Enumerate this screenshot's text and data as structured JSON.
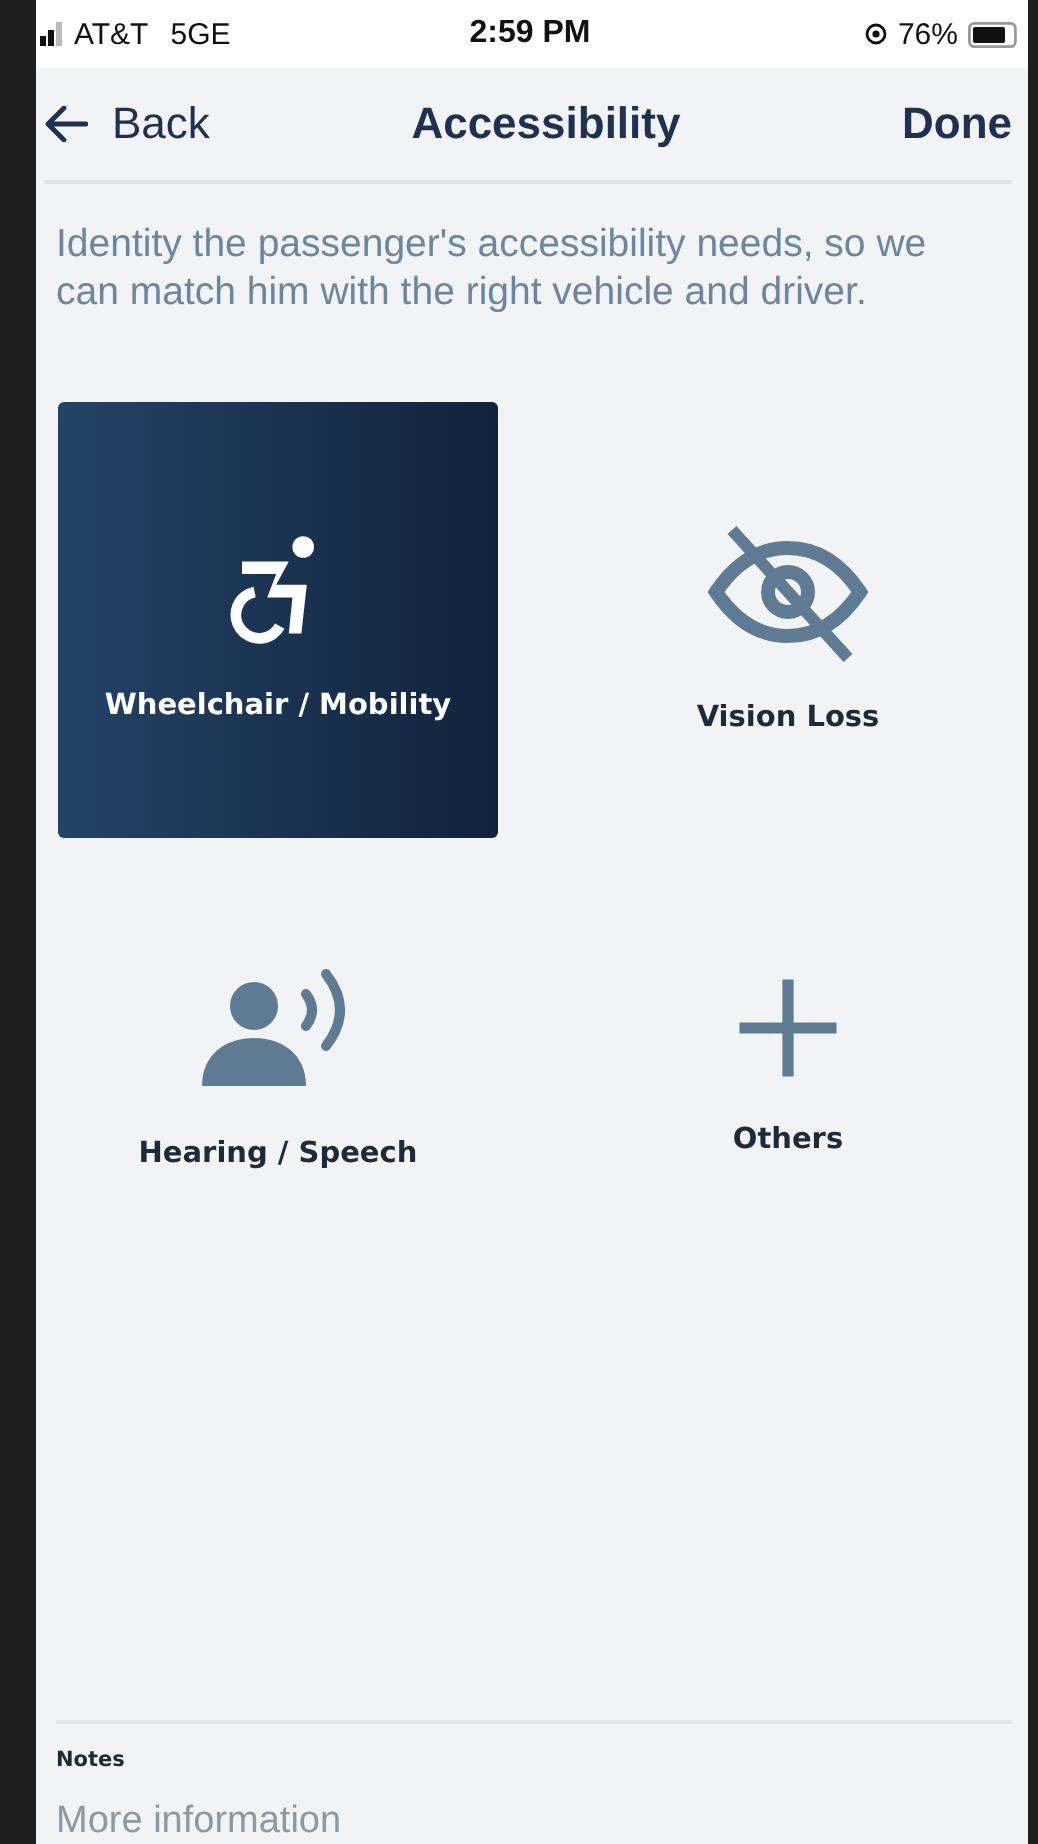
{
  "status_bar": {
    "carrier": "AT&T",
    "network": "5GE",
    "time": "2:59 PM",
    "battery": "76%"
  },
  "nav": {
    "back": "Back",
    "title": "Accessibility",
    "done": "Done"
  },
  "description": "Identity the passenger's accessibility needs, so we can match him with the right vehicle and driver.",
  "options": [
    {
      "kind": "wheelchair",
      "label": "Wheelchair / Mobility",
      "selected": true
    },
    {
      "kind": "vision",
      "label": "Vision Loss",
      "selected": false
    },
    {
      "kind": "hearing",
      "label": "Hearing / Speech",
      "selected": false
    },
    {
      "kind": "other",
      "label": "Others",
      "selected": false
    }
  ],
  "notes": {
    "label": "Notes",
    "placeholder": "More information"
  }
}
